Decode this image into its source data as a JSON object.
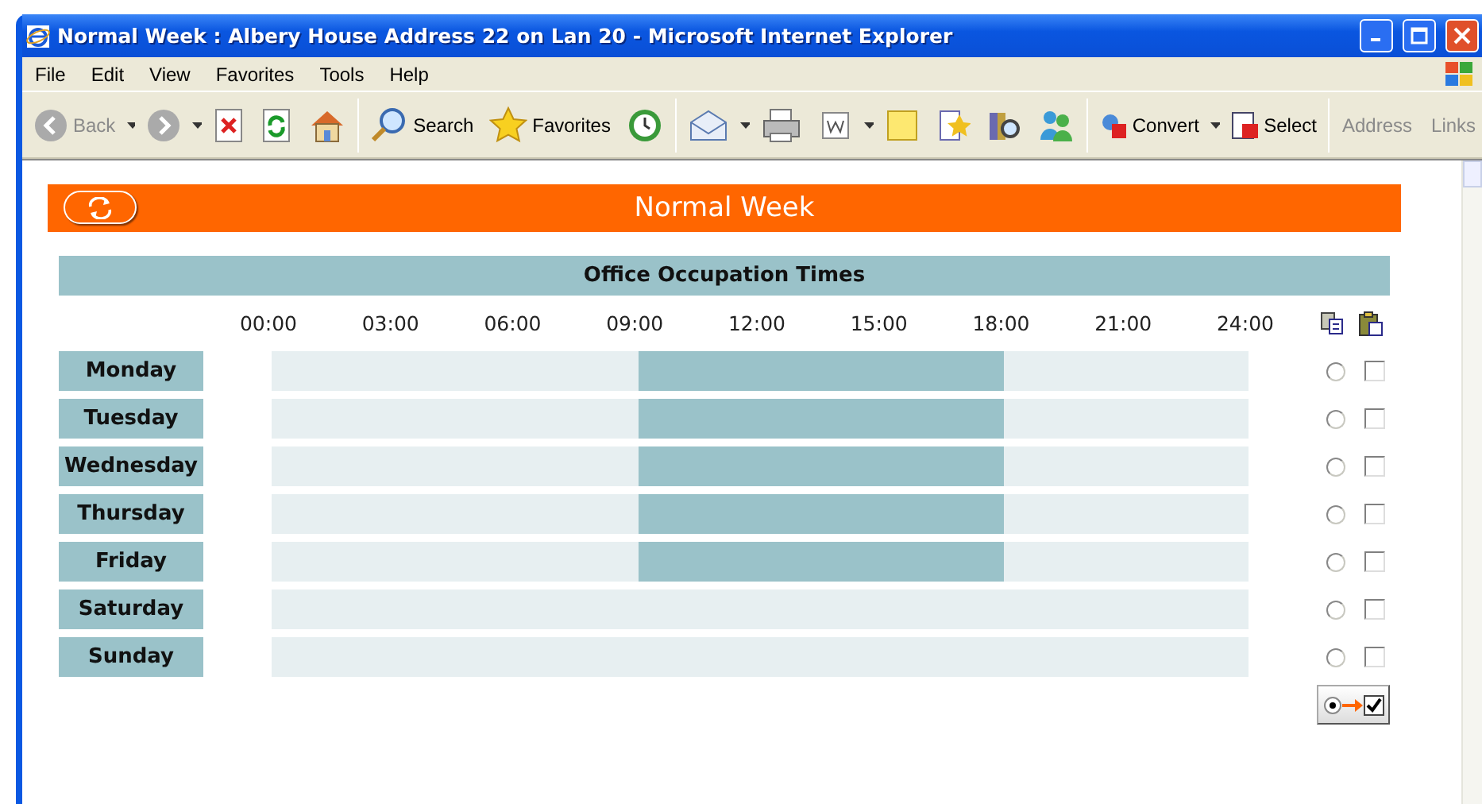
{
  "window": {
    "title": "Normal Week : Albery House Address 22 on Lan 20 - Microsoft Internet Explorer"
  },
  "menu": [
    "File",
    "Edit",
    "View",
    "Favorites",
    "Tools",
    "Help"
  ],
  "toolbar": [
    {
      "kind": "nav",
      "label": "Back",
      "disabled": true,
      "dropdown": true
    },
    {
      "kind": "nav",
      "disabled": true,
      "dropdown": true
    },
    {
      "kind": "icon"
    },
    {
      "kind": "icon"
    },
    {
      "kind": "icon"
    },
    {
      "kind": "sep"
    },
    {
      "kind": "labeled",
      "label": "Search"
    },
    {
      "kind": "labeled",
      "label": "Favorites"
    },
    {
      "kind": "icon"
    },
    {
      "kind": "sep"
    },
    {
      "kind": "icon",
      "dropdown": true
    },
    {
      "kind": "icon"
    },
    {
      "kind": "icon",
      "dropdown": true
    },
    {
      "kind": "icon"
    },
    {
      "kind": "icon"
    },
    {
      "kind": "icon"
    },
    {
      "kind": "icon"
    },
    {
      "kind": "sep"
    },
    {
      "kind": "labeled",
      "label": "Convert",
      "dropdown": true
    },
    {
      "kind": "labeled",
      "label": "Select"
    },
    {
      "kind": "sep"
    },
    {
      "kind": "text",
      "label": "Address"
    },
    {
      "kind": "text",
      "label": "Links"
    }
  ],
  "header": {
    "title": "Normal Week"
  },
  "table": {
    "title": "Office Occupation Times",
    "ticks": [
      "00:00",
      "03:00",
      "06:00",
      "09:00",
      "12:00",
      "15:00",
      "18:00",
      "21:00",
      "24:00"
    ],
    "rows": [
      {
        "day": "Monday",
        "slots": [
          false,
          false,
          false,
          true,
          true,
          true,
          false,
          false
        ],
        "selected": false,
        "checked": false
      },
      {
        "day": "Tuesday",
        "slots": [
          false,
          false,
          false,
          true,
          true,
          true,
          false,
          false
        ],
        "selected": false,
        "checked": false
      },
      {
        "day": "Wednesday",
        "slots": [
          false,
          false,
          false,
          true,
          true,
          true,
          false,
          false
        ],
        "selected": false,
        "checked": false
      },
      {
        "day": "Thursday",
        "slots": [
          false,
          false,
          false,
          true,
          true,
          true,
          false,
          false
        ],
        "selected": false,
        "checked": false
      },
      {
        "day": "Friday",
        "slots": [
          false,
          false,
          false,
          true,
          true,
          true,
          false,
          false
        ],
        "selected": false,
        "checked": false
      },
      {
        "day": "Saturday",
        "slots": [
          false,
          false,
          false,
          false,
          false,
          false,
          false,
          false
        ],
        "selected": false,
        "checked": false
      },
      {
        "day": "Sunday",
        "slots": [
          false,
          false,
          false,
          false,
          false,
          false,
          false,
          false
        ],
        "selected": false,
        "checked": false
      }
    ]
  }
}
